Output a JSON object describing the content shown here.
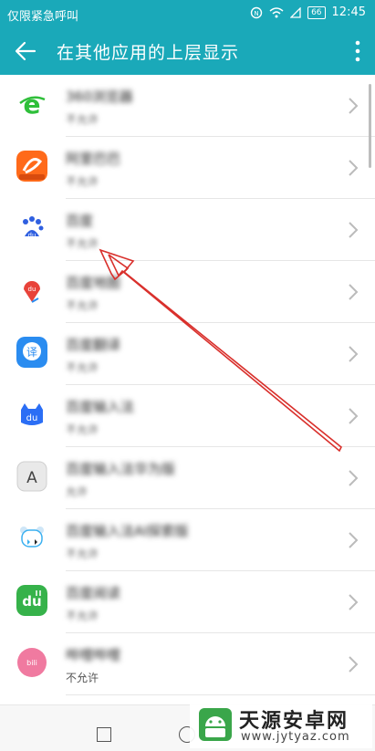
{
  "status_bar": {
    "carrier": "仅限紧急呼叫",
    "battery": "66",
    "time": "12:45"
  },
  "app_bar": {
    "title": "在其他应用的上层显示",
    "back_icon": "arrow-back-icon",
    "more_icon": "more-vert-icon"
  },
  "apps": [
    {
      "name": "360浏览器",
      "status": "不允许",
      "icon": "360-browser-icon",
      "color": "#2fbf3a"
    },
    {
      "name": "阿里巴巴",
      "status": "不允许",
      "icon": "alibaba-icon",
      "color": "#ff6a1a"
    },
    {
      "name": "百度",
      "status": "不允许",
      "icon": "baidu-icon",
      "color": "#2f5fe0"
    },
    {
      "name": "百度地图",
      "status": "不允许",
      "icon": "baidu-map-icon",
      "color": "#e8433a"
    },
    {
      "name": "百度翻译",
      "status": "不允许",
      "icon": "baidu-translate-icon",
      "color": "#2a8cf0"
    },
    {
      "name": "百度输入法",
      "status": "不允许",
      "icon": "baidu-input-icon",
      "color": "#2b6ef5"
    },
    {
      "name": "百度输入法华为版",
      "status": "允许",
      "icon": "baidu-input-huawei-icon",
      "color": "#d9d9d9"
    },
    {
      "name": "百度输入法AI探索版",
      "status": "不允许",
      "icon": "baidu-input-ai-icon",
      "color": "#3ab0f0"
    },
    {
      "name": "百度阅读",
      "status": "不允许",
      "icon": "baidu-reading-icon",
      "color": "#36b24a"
    },
    {
      "name": "哔哩哔哩",
      "status": "不允许",
      "icon": "bilibili-icon",
      "color": "#f07aa0"
    }
  ],
  "watermark": {
    "title": "天源安卓网",
    "url": "www.jytyaz.com"
  }
}
